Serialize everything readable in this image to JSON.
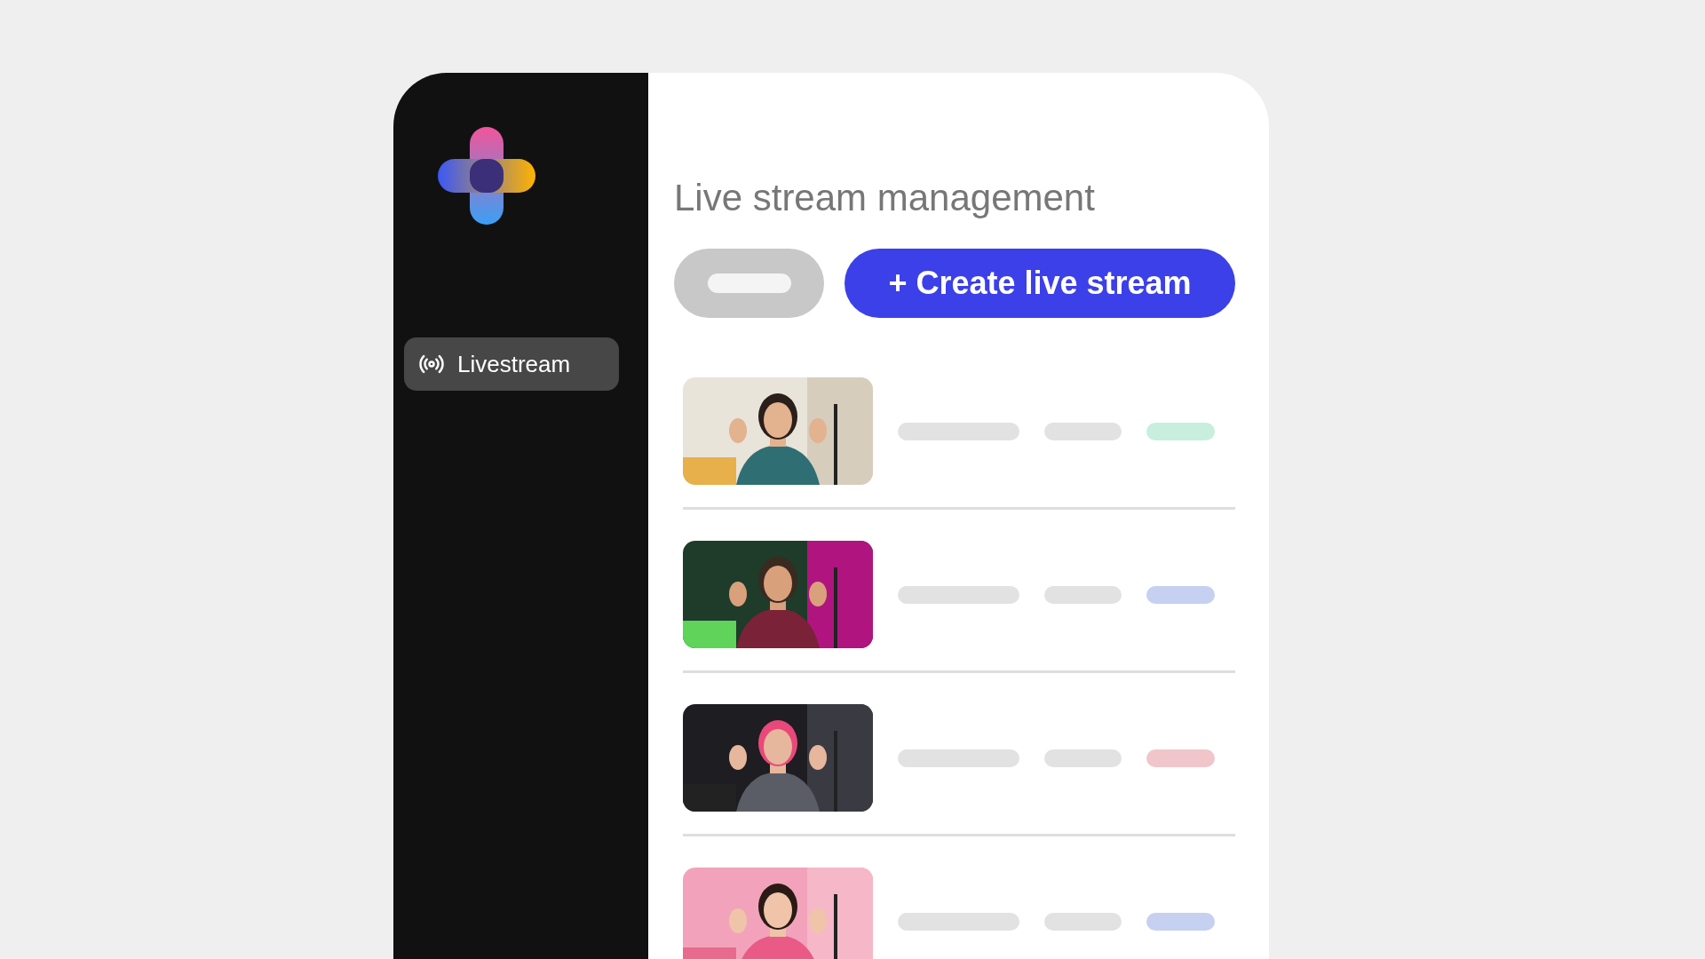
{
  "title": "Live stream management",
  "sidebar": {
    "items": [
      {
        "label": "Livestream",
        "selected": true
      }
    ]
  },
  "toolbar": {
    "create_button": "+ Create live stream"
  }
}
